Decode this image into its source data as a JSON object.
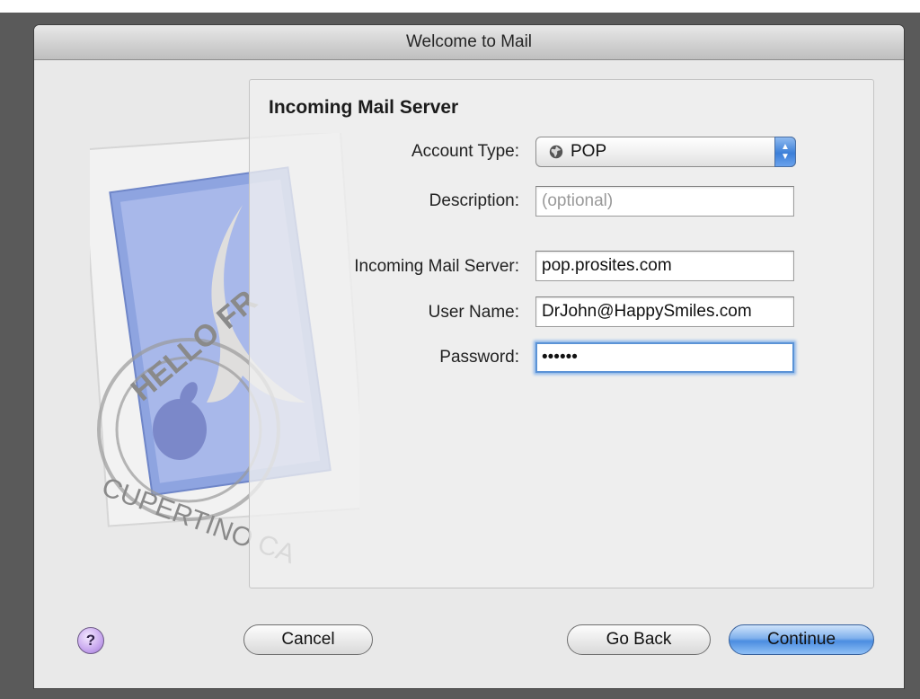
{
  "window": {
    "title": "Welcome to Mail"
  },
  "stamp": {
    "text_top": "HELLO FR",
    "text_bottom": "CUPERTINO CA"
  },
  "panel": {
    "heading": "Incoming Mail Server",
    "account_type": {
      "label": "Account Type:",
      "value": "POP",
      "icon": "globe-icon"
    },
    "description": {
      "label": "Description:",
      "placeholder": "(optional)"
    },
    "incoming_server": {
      "label": "Incoming Mail Server:",
      "value": "pop.prosites.com"
    },
    "user_name": {
      "label": "User Name:",
      "value": "DrJohn@HappySmiles.com"
    },
    "password": {
      "label": "Password:",
      "value": "••••••"
    }
  },
  "buttons": {
    "help": "?",
    "cancel": "Cancel",
    "go_back": "Go Back",
    "continue": "Continue"
  },
  "colors": {
    "accent": "#4b8de0",
    "focus_ring": "#5b93d6"
  }
}
